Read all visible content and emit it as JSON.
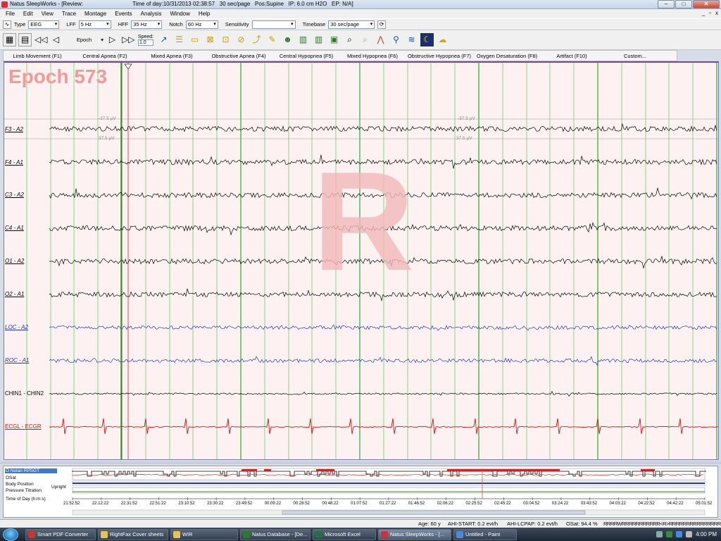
{
  "window": {
    "title": "Natus SleepWorks - [Review:",
    "status_info": "Time of day:10/31/2013 02:38:57   30 sec/page   Pos:Supine   IP: 6.0 cm H2O   EP: N/A]",
    "minimize": "–",
    "maximize": "□",
    "close": "✕"
  },
  "menu": [
    "File",
    "Edit",
    "View",
    "Trace",
    "Montage",
    "Events",
    "Analysis",
    "Window",
    "Help"
  ],
  "mdi_controls": [
    "_",
    "▫",
    "x"
  ],
  "filters": {
    "type_label": "Type",
    "type_value": "EEG",
    "lff_label": "LFF",
    "lff_value": "5 Hz",
    "hff_label": "HFF",
    "hff_value": "35 Hz",
    "notch_label": "Notch",
    "notch_value": "60 Hz",
    "sensitivity_label": "Sensitivity",
    "sensitivity_value": "",
    "timebase_label": "Timebase",
    "timebase_value": "30 sec/page"
  },
  "toolbar": {
    "epoch_select": "Epoch",
    "speed_label": "Speed:",
    "speed_value": "1.0",
    "icons": [
      "save-icon",
      "print-icon",
      "rewind-icon",
      "back-icon",
      "play-icon",
      "fast-forward-icon",
      "stage-icon",
      "note-icon",
      "event-icon",
      "hypnogram-icon",
      "marker-icon",
      "zoom-icon",
      "zoom-out-icon",
      "trend-icon",
      "calibrate-icon",
      "night-mode-icon",
      "weather-icon"
    ]
  },
  "event_buttons": [
    "Limb Movement (F1)",
    "Central Apnea (F2)",
    "Mixed Apnea (F3)",
    "Obstructive Apnea (F4)",
    "Central Hypopnea (F5)",
    "Mixed Hypopnea (F6)",
    "Obstructive Hypopnea (F7)",
    "Oxygen Desaturation (F8)",
    "Artifact (F10)",
    "Custom..."
  ],
  "epoch": {
    "label": "Epoch 573",
    "stage": "R"
  },
  "scale_labels": [
    "-37.5 μV",
    "37.5 μV"
  ],
  "channels": [
    {
      "name": "F3 - A2",
      "color": "#000000"
    },
    {
      "name": "F4 - A1",
      "color": "#000000"
    },
    {
      "name": "C3 - A2",
      "color": "#000000"
    },
    {
      "name": "C4 - A1",
      "color": "#000000"
    },
    {
      "name": "O1 - A2",
      "color": "#000000"
    },
    {
      "name": "O2 - A1",
      "color": "#000000"
    },
    {
      "name": "LOC - A2",
      "color": "#2233cc"
    },
    {
      "name": "ROC - A1",
      "color": "#2233cc"
    },
    {
      "name": "CHIN1 - CHIN2",
      "color": "#000000"
    },
    {
      "name": "ECGL - ECGR",
      "color": "#dd1111"
    }
  ],
  "overview": {
    "rows": [
      "O Nolan RPSGT",
      "OSat",
      "Body Position",
      "Pressure Titration",
      "Time of Day (h:m:s)"
    ],
    "pos_labels": [
      "Upright"
    ],
    "times": [
      "21:52:52",
      "22:12:22",
      "22:31:52",
      "22:51:22",
      "23:10:52",
      "23:30:22",
      "23:49:52",
      "00:09:22",
      "00:28:52",
      "00:48:22",
      "01:07:52",
      "01:27:22",
      "01:46:52",
      "02:06:22",
      "02:25:52",
      "02:45:22",
      "03:04:52",
      "03:24:22",
      "03:43:52",
      "04:03:22",
      "04:22:52",
      "04:42:22",
      "05:01:52"
    ]
  },
  "status": {
    "age": "Age: 60 y",
    "ahi_start": "AHI-START: 0.2 evt/h",
    "ahi_lcpap": "AHI-LCPAP: 0.2 evt/h",
    "osat": "OSat: 94.4 %",
    "stages": "RRRRWRRRRRRRRRRR<R>RRRRRRRRRRRRRRR"
  },
  "taskbar": {
    "items": [
      "Smart PDF Converter",
      "RightFax Cover sheets",
      "WIR",
      "Natus Database - [De...",
      "Microsoft Excel",
      "Natus SleepWorks - [...",
      "Untitled - Paint"
    ],
    "clock": "4:00 PM"
  }
}
